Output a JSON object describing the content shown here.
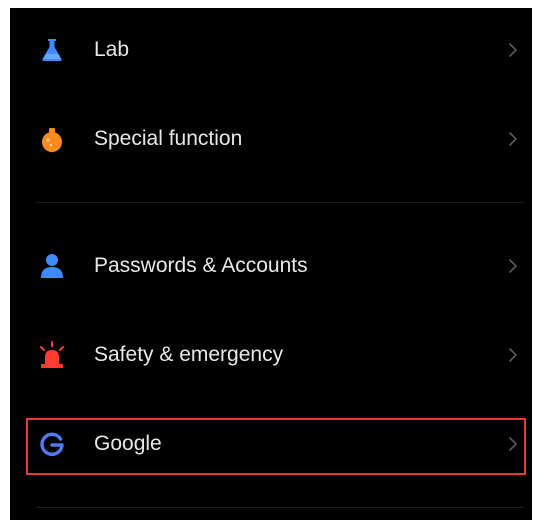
{
  "items": [
    {
      "label": "Lab",
      "icon": "flask-icon",
      "color": "#3d8bfd"
    },
    {
      "label": "Special function",
      "icon": "potion-icon",
      "color": "#ff8a1e"
    },
    {
      "label": "Passwords & Accounts",
      "icon": "person-icon",
      "color": "#3d8bfd"
    },
    {
      "label": "Safety & emergency",
      "icon": "alarm-light-icon",
      "color": "#ff3b30"
    },
    {
      "label": "Google",
      "icon": "google-g-icon",
      "color": "#4f7bf3"
    }
  ],
  "colors": {
    "background": "#000000",
    "text": "#e8e8e8",
    "chevron": "#5a5a5a",
    "highlight": "#e53935"
  }
}
